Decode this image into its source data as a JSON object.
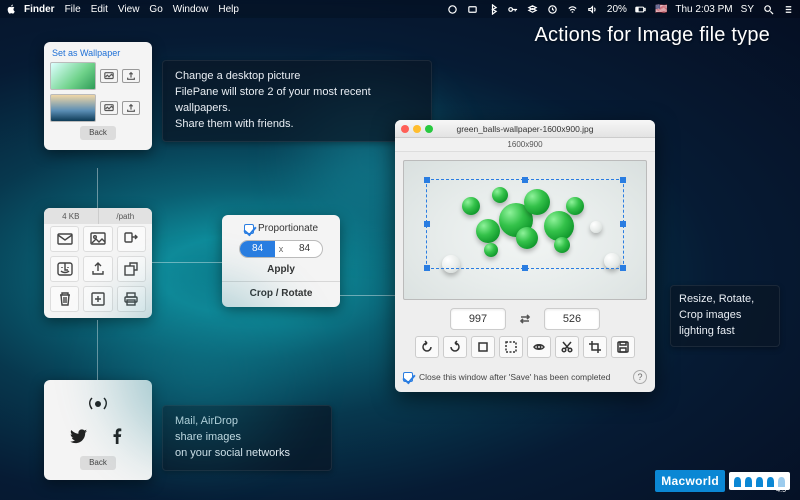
{
  "menubar": {
    "app": "Finder",
    "items": [
      "File",
      "Edit",
      "View",
      "Go",
      "Window",
      "Help"
    ],
    "battery": "20%",
    "clock": "Thu 2:03 PM",
    "user": "SY",
    "flag": "🇺🇸"
  },
  "headline": "Actions for Image file type",
  "captions": {
    "wallpaper": {
      "l1": "Change a desktop picture",
      "l2": "FilePane will store 2 of your most recent wallpapers.",
      "l3": "Share them with friends."
    },
    "share": {
      "l1": "Mail,  AirDrop",
      "l2": "share images",
      "l3": "on your social networks"
    },
    "resize": {
      "l1": "Resize, Rotate,",
      "l2": "Crop  images",
      "l3": "lighting fast"
    }
  },
  "wallpaper_panel": {
    "title": "Set as Wallpaper",
    "back": "Back"
  },
  "grid_panel": {
    "tab_size": "4 KB",
    "tab_path": "/path"
  },
  "share_panel": {
    "back": "Back"
  },
  "resize_panel": {
    "proportionate": "Proportionate",
    "width": "84",
    "height": "84",
    "apply": "Apply",
    "crop_rotate": "Crop / Rotate"
  },
  "editor": {
    "filename": "green_balls-wallpaper-1600x900.jpg",
    "dimensions_label": "1600x900",
    "crop_w": "997",
    "crop_h": "526",
    "close_after_save": "Close this window after 'Save' has been completed"
  },
  "badge": {
    "brand": "Macworld",
    "score": "4.5"
  }
}
